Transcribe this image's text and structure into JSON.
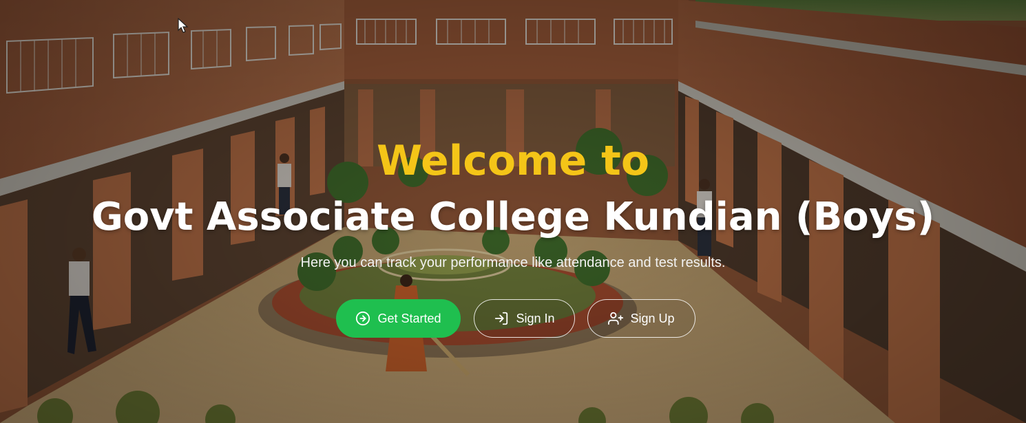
{
  "hero": {
    "heading_line1": "Welcome to",
    "heading_line2": "Govt Associate College Kundian (Boys)",
    "subtitle": "Here you can track your performance like attendance and test results."
  },
  "buttons": {
    "get_started": {
      "label": "Get Started",
      "icon": "arrow-right-circle-icon",
      "color": "#1fbf4f"
    },
    "sign_in": {
      "label": "Sign In",
      "icon": "log-in-icon"
    },
    "sign_up": {
      "label": "Sign Up",
      "icon": "user-plus-icon"
    }
  },
  "colors": {
    "heading_accent": "#f4c518",
    "heading_main": "#ffffff",
    "primary_button": "#1fbf4f"
  }
}
